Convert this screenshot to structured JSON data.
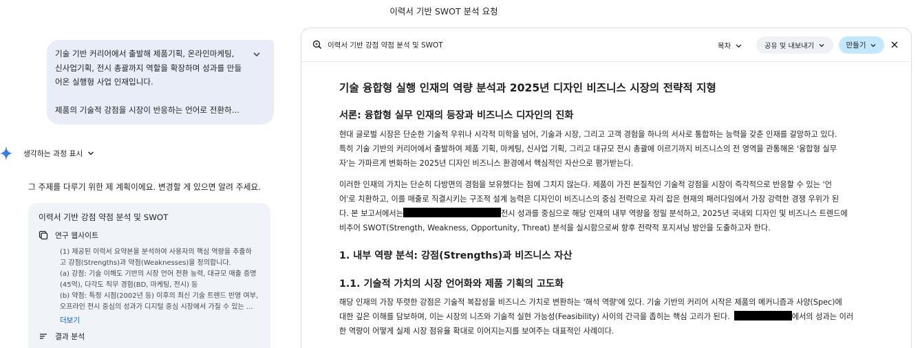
{
  "page_title": "이력서 기반 SWOT 분석 요청",
  "user_message": {
    "lines": [
      "기술 기반 커리어에서 출발해 제품기획, 온라인마케팅,",
      "신사업기획, 전시 총괄까지 역할을 확장하며 성과를 만들",
      "어온 실행형 사업 인재입니다.",
      "제품의 기술적 강점을 시장이 반응하는 언어로 전환하..."
    ]
  },
  "thinking": {
    "label": "생각하는 과정 표시"
  },
  "plan_intro": "그 주제를 다루기 위한 제 계획이에요. 변경할 게 있으면 알려 주세요.",
  "plan_card": {
    "title": "이력서 기반 강점 약점 분석 및 SWOT",
    "step1": {
      "label": "연구 웹사이트",
      "lines": [
        "(1) 제공된 이력서 요약본을 분석하여 사용자의 핵심 역량을 추출하",
        "고 강점(Strengths)과 약점(Weaknesses)을 정의합니다.",
        "(a) 강점: 기술 이해도 기반의 시장 언어 전환 능력, 대규모 매출 증명",
        "(45억), 다각도 직무 경험(BD, 마케팅, 전시) 등",
        "(b) 약점: 특정 시점(2002년 등) 이후의 최신 기술 트렌드 반영 여부,",
        "오프라인 전시 중심의 성과가 디지털 중심 시장에서 가질 수 있는 ..."
      ],
      "more": "더보기"
    },
    "step2": {
      "label": "결과 분석"
    }
  },
  "doc": {
    "header_title": "이력서 기반 강점 약점 분석 및 SWOT",
    "toc_label": "목차",
    "share_label": "공유 및 내보내기",
    "create_label": "만들기",
    "h1": "기술 융합형 실행 인재의 역량 분석과 2025년 디자인 비즈니스 시장의 전략적 지형",
    "section_intro": "서론: 융합형 실무 인재의 등장과 비즈니스 디자인의 진화",
    "p1": [
      "현대 글로벌 시장은 단순한 기술적 우위나 시각적 미학을 넘어, 기술과 시장, 그리고 고객 경험을 하나의 서사로 통합하는 능력을 갖춘 인재를 갈망하고 있다.",
      "특히 기술 기반의 커리어에서 출발하여 제품 기획, 마케팅, 신사업 기획, 그리고 대규모 전시 총괄에 이르기까지 비즈니스의 전 영역을 관통해온 '융합형 실무",
      "자'는 가파르게 변화하는 2025년 디자인 비즈니스 환경에서 핵심적인 자산으로 평가받는다."
    ],
    "p2": [
      "이러한 인재의 가치는 단순히 다방면의 경험을 보유했다는 점에 그치지 않는다. 제품이 가진 본질적인 기술적 강점을 시장이 즉각적으로 반응할 수 있는 '언",
      "어'로 치환하고, 이를 매출로 직결시키는 구조적 설계 능력은 디자인이 비즈니스의 중심 전략으로 자리 잡은 현재의 패러다임에서 가장 강력한 경쟁 우위가 된"
    ],
    "p2_line3_pre": "다. 본 보고서에서는",
    "p2_line3_post": "전시 성과를 중심으로 해당 인재의 내부 역량을 정밀 분석하고, 2025년 국내외 디자인 및 비즈니스 트렌드에",
    "p2_line4": "비추어 SWOT(Strength, Weakness, Opportunity, Threat) 분석을 실시함으로써 향후 전략적 포지셔닝 방안을 도출하고자 한다.",
    "h2_strengths": "1. 내부 역량 분석: 강점(Strengths)과 비즈니스 자산",
    "h3_tech": "1.1. 기술적 가치의 시장 언어화와 제품 기획의 고도화",
    "p3_line1": "해당 인재의 가장 뚜렷한 강점은 기술적 복잡성을 비즈니스 가치로 변환하는 '해석 역량'에 있다. 기술 기반의 커리어 시작은 제품의 메커니즘과 사양(Spec)에",
    "p3_line2_pre": "대한 깊은 이해를 담보하며, 이는 시장의 니즈와 기술적 실현 가능성(Feasibility) 사이의 간극을 좁히는 핵심 고리가 된다.",
    "p3_line2_post": "에서의 성과는 이러",
    "p3_line3": "한 역량이 어떻게 실제 시장 점유율 확대로 이어지는지를 보여주는 대표적인 사례이다."
  }
}
